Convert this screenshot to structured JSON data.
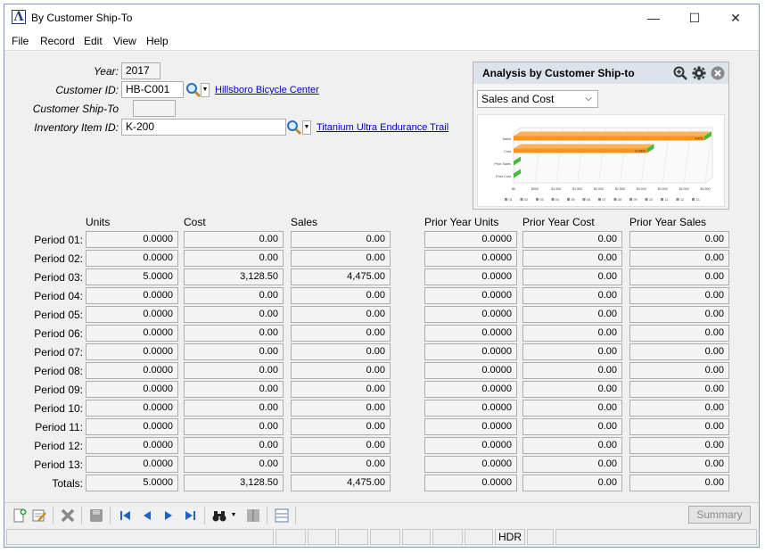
{
  "window": {
    "title": "By Customer Ship-To",
    "logo": "Λ",
    "minimize": "—",
    "maximize": "☐",
    "close": "✕"
  },
  "menu": [
    "File",
    "Record",
    "Edit",
    "View",
    "Help"
  ],
  "form": {
    "year": {
      "label": "Year:",
      "value": "2017"
    },
    "customer_id": {
      "label": "Customer ID:",
      "value": "HB-C001",
      "link": "Hillsboro Bicycle Center"
    },
    "ship_to": {
      "label": "Customer Ship-To",
      "value": ""
    },
    "item_id": {
      "label": "Inventory Item ID:",
      "value": "K-200",
      "link": "Titanium Ultra Endurance Trail"
    }
  },
  "columns": {
    "units": "Units",
    "cost": "Cost",
    "sales": "Sales",
    "py_units": "Prior Year Units",
    "py_cost": "Prior Year Cost",
    "py_sales": "Prior Year Sales"
  },
  "periods": [
    {
      "label": "Period 01:",
      "units": "0.0000",
      "cost": "0.00",
      "sales": "0.00",
      "py_units": "0.0000",
      "py_cost": "0.00",
      "py_sales": "0.00"
    },
    {
      "label": "Period 02:",
      "units": "0.0000",
      "cost": "0.00",
      "sales": "0.00",
      "py_units": "0.0000",
      "py_cost": "0.00",
      "py_sales": "0.00"
    },
    {
      "label": "Period 03:",
      "units": "5.0000",
      "cost": "3,128.50",
      "sales": "4,475.00",
      "py_units": "0.0000",
      "py_cost": "0.00",
      "py_sales": "0.00"
    },
    {
      "label": "Period 04:",
      "units": "0.0000",
      "cost": "0.00",
      "sales": "0.00",
      "py_units": "0.0000",
      "py_cost": "0.00",
      "py_sales": "0.00"
    },
    {
      "label": "Period 05:",
      "units": "0.0000",
      "cost": "0.00",
      "sales": "0.00",
      "py_units": "0.0000",
      "py_cost": "0.00",
      "py_sales": "0.00"
    },
    {
      "label": "Period 06:",
      "units": "0.0000",
      "cost": "0.00",
      "sales": "0.00",
      "py_units": "0.0000",
      "py_cost": "0.00",
      "py_sales": "0.00"
    },
    {
      "label": "Period 07:",
      "units": "0.0000",
      "cost": "0.00",
      "sales": "0.00",
      "py_units": "0.0000",
      "py_cost": "0.00",
      "py_sales": "0.00"
    },
    {
      "label": "Period 08:",
      "units": "0.0000",
      "cost": "0.00",
      "sales": "0.00",
      "py_units": "0.0000",
      "py_cost": "0.00",
      "py_sales": "0.00"
    },
    {
      "label": "Period 09:",
      "units": "0.0000",
      "cost": "0.00",
      "sales": "0.00",
      "py_units": "0.0000",
      "py_cost": "0.00",
      "py_sales": "0.00"
    },
    {
      "label": "Period 10:",
      "units": "0.0000",
      "cost": "0.00",
      "sales": "0.00",
      "py_units": "0.0000",
      "py_cost": "0.00",
      "py_sales": "0.00"
    },
    {
      "label": "Period 11:",
      "units": "0.0000",
      "cost": "0.00",
      "sales": "0.00",
      "py_units": "0.0000",
      "py_cost": "0.00",
      "py_sales": "0.00"
    },
    {
      "label": "Period 12:",
      "units": "0.0000",
      "cost": "0.00",
      "sales": "0.00",
      "py_units": "0.0000",
      "py_cost": "0.00",
      "py_sales": "0.00"
    },
    {
      "label": "Period 13:",
      "units": "0.0000",
      "cost": "0.00",
      "sales": "0.00",
      "py_units": "0.0000",
      "py_cost": "0.00",
      "py_sales": "0.00"
    },
    {
      "label": "Totals:",
      "units": "5.0000",
      "cost": "3,128.50",
      "sales": "4,475.00",
      "py_units": "0.0000",
      "py_cost": "0.00",
      "py_sales": "0.00"
    }
  ],
  "analysis": {
    "title": "Analysis by Customer Ship-to",
    "selected": "Sales and Cost",
    "icons": [
      "zoom-icon",
      "gear-icon",
      "close-circle-icon"
    ]
  },
  "chart_data": {
    "type": "bar",
    "orientation": "horizontal",
    "categories": [
      "Sales",
      "Cost",
      "Prior Sales",
      "Prior Cost"
    ],
    "values": [
      4475,
      3128.5,
      0,
      0
    ],
    "value_labels": [
      "4,475",
      "3,128.5",
      "",
      ""
    ],
    "x_ticks": [
      "$0",
      "$500",
      "$1,000",
      "$1,500",
      "$2,000",
      "$2,500",
      "$3,000",
      "$3,500",
      "$4,000",
      "$4,500"
    ],
    "xlim": [
      0,
      4500
    ],
    "legend": [
      "01",
      "02",
      "03",
      "04",
      "05",
      "06",
      "07",
      "08",
      "09",
      "10",
      "11",
      "12",
      "13"
    ],
    "legend_placement": "bottom",
    "bar_color": "#f7941d",
    "end_color": "#46b83a"
  },
  "toolbar": {
    "summary_label": "Summary",
    "icons": [
      "new-record-icon",
      "edit-record-icon",
      "delete-icon",
      "save-icon",
      "first-icon",
      "previous-icon",
      "next-icon",
      "last-icon",
      "binoculars-icon",
      "dropdown-icon",
      "view-icon",
      "list-icon"
    ]
  },
  "status": {
    "hdr": "HDR"
  }
}
